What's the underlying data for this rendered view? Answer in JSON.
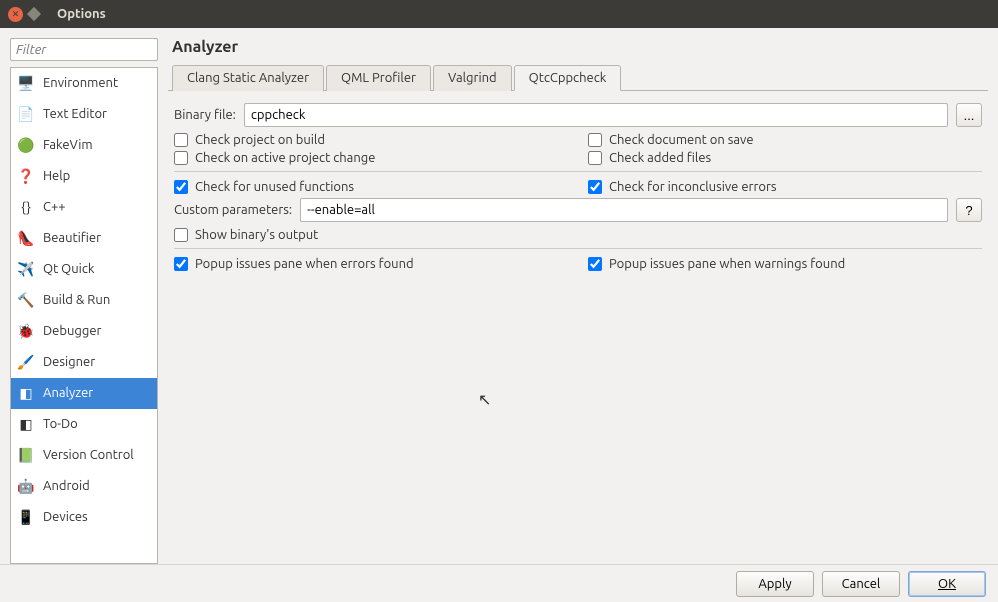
{
  "window": {
    "title": "Options"
  },
  "filter": {
    "placeholder": "Filter"
  },
  "categories": [
    {
      "label": "Environment",
      "icon": "🖥️",
      "selected": false
    },
    {
      "label": "Text Editor",
      "icon": "📄",
      "selected": false
    },
    {
      "label": "FakeVim",
      "icon": "🟢",
      "selected": false
    },
    {
      "label": "Help",
      "icon": "❓",
      "selected": false
    },
    {
      "label": "C++",
      "icon": "{}",
      "selected": false
    },
    {
      "label": "Beautifier",
      "icon": "👠",
      "selected": false
    },
    {
      "label": "Qt Quick",
      "icon": "✈️",
      "selected": false
    },
    {
      "label": "Build & Run",
      "icon": "🔨",
      "selected": false
    },
    {
      "label": "Debugger",
      "icon": "🐞",
      "selected": false
    },
    {
      "label": "Designer",
      "icon": "🖌️",
      "selected": false
    },
    {
      "label": "Analyzer",
      "icon": "◧",
      "selected": true
    },
    {
      "label": "To-Do",
      "icon": "◧",
      "selected": false
    },
    {
      "label": "Version Control",
      "icon": "📗",
      "selected": false
    },
    {
      "label": "Android",
      "icon": "🤖",
      "selected": false
    },
    {
      "label": "Devices",
      "icon": "📱",
      "selected": false
    }
  ],
  "page": {
    "title": "Analyzer"
  },
  "tabs": [
    {
      "label": "Clang Static Analyzer",
      "active": false
    },
    {
      "label": "QML Profiler",
      "active": false
    },
    {
      "label": "Valgrind",
      "active": false
    },
    {
      "label": "QtcCppcheck",
      "active": true
    }
  ],
  "form": {
    "binary_label": "Binary file:",
    "binary_value": "cppcheck",
    "browse_label": "...",
    "custom_label": "Custom parameters:",
    "custom_value": "--enable=all",
    "help_label": "?",
    "checks": {
      "on_build": {
        "label": "Check project on build",
        "checked": false
      },
      "on_save": {
        "label": "Check document on save",
        "checked": false
      },
      "on_proj_change": {
        "label": "Check on active project change",
        "checked": false
      },
      "added_files": {
        "label": "Check added files",
        "checked": false
      },
      "unused_fn": {
        "label": "Check for unused functions",
        "checked": true
      },
      "inconclusive": {
        "label": "Check for inconclusive errors",
        "checked": true
      },
      "show_output": {
        "label": "Show binary's output",
        "checked": false
      },
      "popup_errors": {
        "label": "Popup issues pane when errors found",
        "checked": true
      },
      "popup_warnings": {
        "label": "Popup issues pane when warnings found",
        "checked": true
      }
    }
  },
  "buttons": {
    "apply": "Apply",
    "cancel": "Cancel",
    "ok": "OK"
  }
}
